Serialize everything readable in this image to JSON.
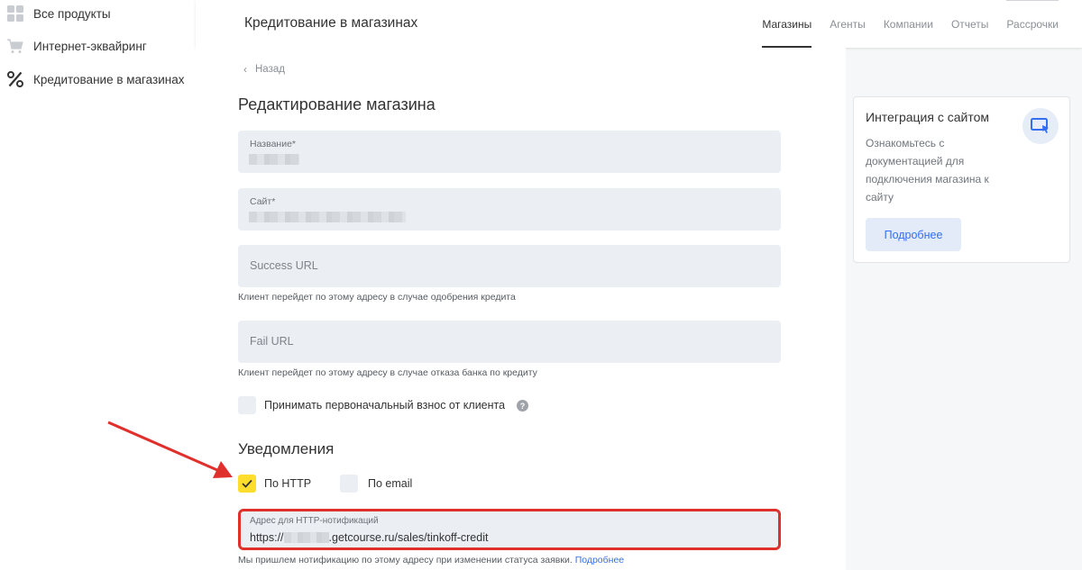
{
  "sidebar": {
    "items": [
      {
        "label": "Все продукты",
        "icon": "grid-icon"
      },
      {
        "label": "Интернет-эквайринг",
        "icon": "cart-icon"
      },
      {
        "label": "Кредитование в магазинах",
        "icon": "percent-icon"
      }
    ]
  },
  "header": {
    "title": "Кредитование в магазинах",
    "tabs": [
      {
        "label": "Магазины",
        "active": true
      },
      {
        "label": "Агенты",
        "active": false
      },
      {
        "label": "Компании",
        "active": false
      },
      {
        "label": "Отчеты",
        "active": false
      },
      {
        "label": "Рассрочки",
        "active": false
      }
    ]
  },
  "main": {
    "back_label": "Назад",
    "title": "Редактирование магазина",
    "fields": {
      "name_label": "Название*",
      "site_label": "Сайт*",
      "success_placeholder": "Success URL",
      "success_hint": "Клиент перейдет по этому адресу в случае одобрения кредита",
      "fail_placeholder": "Fail URL",
      "fail_hint": "Клиент перейдет по этому адресу в случае отказа банка по кредиту"
    },
    "downpayment_label": "Принимать первоначальный взнос от клиента",
    "notifications": {
      "title": "Уведомления",
      "http_label": "По HTTP",
      "http_checked": true,
      "email_label": "По email",
      "email_checked": false,
      "http_field_label": "Адрес для HTTP-нотификаций",
      "http_url_prefix": "https://",
      "http_url_suffix": ".getcourse.ru/sales/tinkoff-credit",
      "note": "Мы пришлем нотификацию по этому адресу при изменении статуса заявки.",
      "note_link": "Подробнее"
    }
  },
  "integration_card": {
    "title": "Интеграция с сайтом",
    "description": "Ознакомьтесь с документацией для подключения магазина к сайту",
    "button": "Подробнее",
    "icon": "monitor-cursor-icon"
  },
  "colors": {
    "accent_yellow": "#ffdd2d",
    "link_blue": "#336fee",
    "highlight_red": "#e0302c"
  }
}
